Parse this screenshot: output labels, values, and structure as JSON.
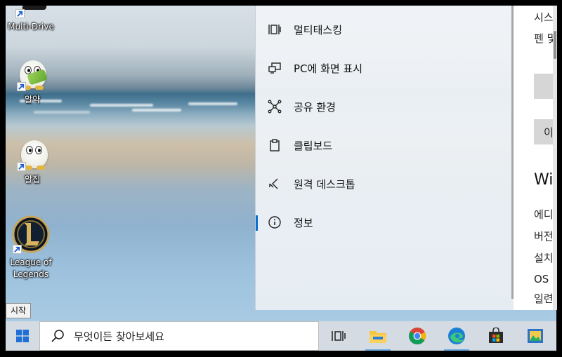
{
  "desktop": {
    "icons": [
      {
        "label": "Multi-Drive",
        "icon": "multi-drive-icon"
      },
      {
        "label": "알약",
        "icon": "alyac-icon"
      },
      {
        "label": "알집",
        "icon": "alzip-icon"
      },
      {
        "label": "League of Legends",
        "label_line1": "League of",
        "label_line2": "Legends",
        "icon": "league-of-legends-icon"
      }
    ],
    "tooltip": "시작"
  },
  "settings": {
    "nav": [
      {
        "label": "멀티태스킹",
        "icon": "multitasking-icon"
      },
      {
        "label": "PC에 화면 표시",
        "icon": "project-to-pc-icon"
      },
      {
        "label": "공유 환경",
        "icon": "shared-experiences-icon"
      },
      {
        "label": "클립보드",
        "icon": "clipboard-icon"
      },
      {
        "label": "원격 데스크톱",
        "icon": "remote-desktop-icon"
      },
      {
        "label": "정보",
        "icon": "info-icon",
        "selected": true
      }
    ],
    "content": {
      "line1": "시스",
      "line2": "펜 및",
      "button2": "이",
      "heading": "Win",
      "spec_rows": [
        "에디",
        "버전",
        "설치",
        "OS 빌",
        "일련"
      ]
    }
  },
  "taskbar": {
    "search_placeholder": "무엇이든 찾아보세요",
    "apps": [
      "task-view-icon",
      "file-explorer-icon",
      "chrome-icon",
      "edge-icon",
      "store-icon",
      "photos-icon"
    ]
  },
  "colors": {
    "accent": "#0a6ed1",
    "taskbar": "#d4dbe2"
  }
}
